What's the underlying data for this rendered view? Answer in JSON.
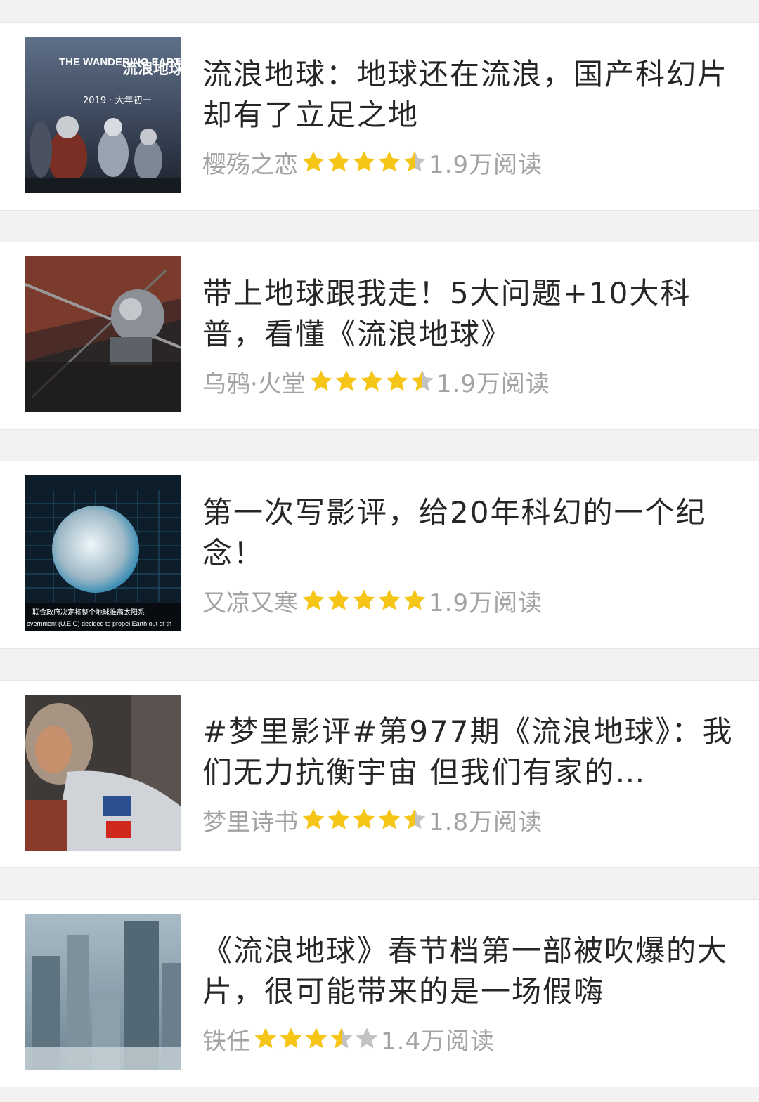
{
  "colors": {
    "star_filled": "#f5c518",
    "star_empty": "#c2c2c2",
    "title_text": "#262626",
    "meta_text": "#a3a3a3"
  },
  "articles": [
    {
      "title": "流浪地球：地球还在流浪，国产科幻片却有了立足之地",
      "author": "樱殇之恋",
      "rating": 4.5,
      "reads": "1.9万阅读",
      "thumbnail": {
        "poster_title_en": "THE WANDERING EARTH",
        "poster_title_cn": "流浪地球",
        "poster_date": "2019 · 大年初一"
      }
    },
    {
      "title": "带上地球跟我走！5大问题+10大科普，看懂《流浪地球》",
      "author": "乌鸦·火堂",
      "rating": 4.5,
      "reads": "1.9万阅读",
      "thumbnail": {}
    },
    {
      "title": "第一次写影评，给20年科幻的一个纪念！",
      "author": "又凉又寒",
      "rating": 5,
      "reads": "1.9万阅读",
      "thumbnail": {
        "caption_cn": "联合政府决定将整个地球推离太阳系",
        "caption_en": "overnment (U.E.G) decided to propel Earth out of th"
      }
    },
    {
      "title": "#梦里影评#第977期《流浪地球》：我们无力抗衡宇宙 但我们有家的…",
      "author": "梦里诗书",
      "rating": 4.5,
      "reads": "1.8万阅读",
      "thumbnail": {}
    },
    {
      "title": "《流浪地球》春节档第一部被吹爆的大片，很可能带来的是一场假嗨",
      "author": "铁任",
      "rating": 3.5,
      "reads": "1.4万阅读",
      "thumbnail": {}
    }
  ]
}
